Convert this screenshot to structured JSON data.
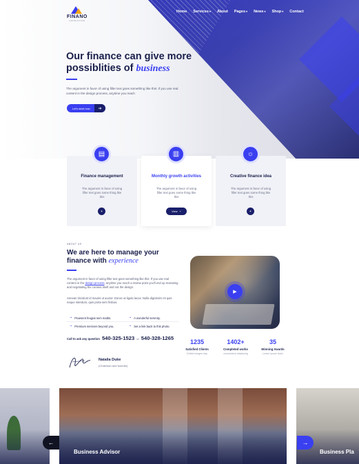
{
  "brand": {
    "name": "FINANO",
    "tagline": "CONSULTING"
  },
  "nav": [
    {
      "label": "Home",
      "dropdown": false
    },
    {
      "label": "Services",
      "dropdown": true
    },
    {
      "label": "About",
      "dropdown": false
    },
    {
      "label": "Pages",
      "dropdown": true
    },
    {
      "label": "News",
      "dropdown": true
    },
    {
      "label": "Shop",
      "dropdown": true
    },
    {
      "label": "Contact",
      "dropdown": false
    }
  ],
  "hero": {
    "title_line1": "Our finance can give more",
    "title_line2_prefix": "possiblities of ",
    "title_accent": "business",
    "description": "The argument in favor of using filler text goes something like this: If you use real content in the design process, anytime you reach",
    "button_label": "Let's start now"
  },
  "services": [
    {
      "title": "Finance management",
      "description": "The argument in favor of using filler text goes some thing like this",
      "icon": "finance-chart-icon"
    },
    {
      "title": "Monthly growth activities",
      "description": "The argument in favor of using filler text goes some thing like this",
      "button_label": "View",
      "icon": "growth-report-icon"
    },
    {
      "title": "Creative finance idea",
      "description": "The argument in favor of using filler text goes some thing like this",
      "icon": "idea-head-icon"
    }
  ],
  "about": {
    "tag": "ABOUT US",
    "title_line1": "We are here to manage your",
    "title_line2_prefix": "finance with ",
    "title_accent": "experience",
    "paragraph1_start": "The argument in favor of using filler text goes something like this: If you use real content in the ",
    "paragraph1_link": "design process",
    "paragraph1_end": ", anytime you reach a review point you'll end up reviewing and negotiating the content itself and not the design.",
    "paragraph2": "Aenean tincidunt id mauris ut auctor. Donec at ligula lacus. Nulla dignissim mi quis neque interdum, quis porta sem finibus.",
    "features": [
      "Praesent feugiat sem mattis.",
      "A wonderful serenity.",
      "Premium services beyond you.",
      "Set a link back to this photo."
    ],
    "call_label": "Call to ask any question",
    "phone1": "540-325-1523",
    "or": "or",
    "phone2": "540-328-1265",
    "signer_name": "Natalia Duke",
    "signer_role": "(Chairman and founder)"
  },
  "stats": [
    {
      "number": "1235",
      "label": "Satisfied Clients",
      "sub": "Delete images day"
    },
    {
      "number": "1402+",
      "label": "Completed works",
      "sub": "consectetur adipiscing"
    },
    {
      "number": "35",
      "label": "Winning Awards",
      "sub": "Lorem ipsum dolor"
    }
  ],
  "slider": {
    "center_title": "Business Advisor",
    "right_title": "Business Pla"
  },
  "colors": {
    "accent": "#3a3ff0",
    "navy": "#1a1f4b",
    "gold": "#f2a51a"
  }
}
